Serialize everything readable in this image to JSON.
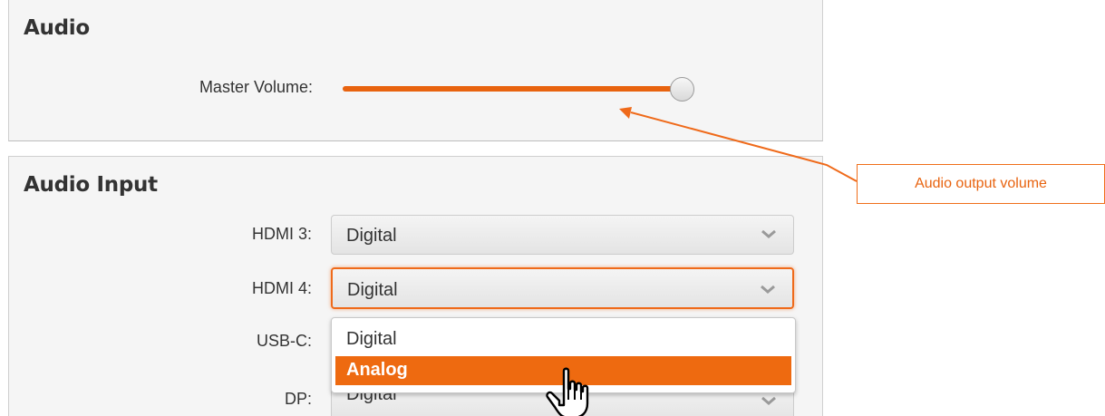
{
  "audio": {
    "title": "Audio",
    "master_volume_label": "Master Volume:",
    "master_volume_level": 1.0
  },
  "audio_input": {
    "title": "Audio Input",
    "rows": [
      {
        "label": "HDMI 3:",
        "value": "Digital"
      },
      {
        "label": "HDMI 4:",
        "value": "Digital"
      },
      {
        "label": "USB-C:",
        "value": ""
      },
      {
        "label": "DP:",
        "value": "Digital"
      }
    ]
  },
  "dropdown": {
    "options": [
      "Digital",
      "Analog"
    ],
    "highlighted": "Analog"
  },
  "callout": {
    "text": "Audio output volume"
  },
  "colors": {
    "accent": "#ee6a10",
    "panel_bg": "#f5f5f5",
    "text": "#333333"
  },
  "icons": {
    "select_arrow": "chevron-down-icon",
    "slider_knob": "slider-thumb",
    "pointer": "hand-cursor-icon"
  }
}
